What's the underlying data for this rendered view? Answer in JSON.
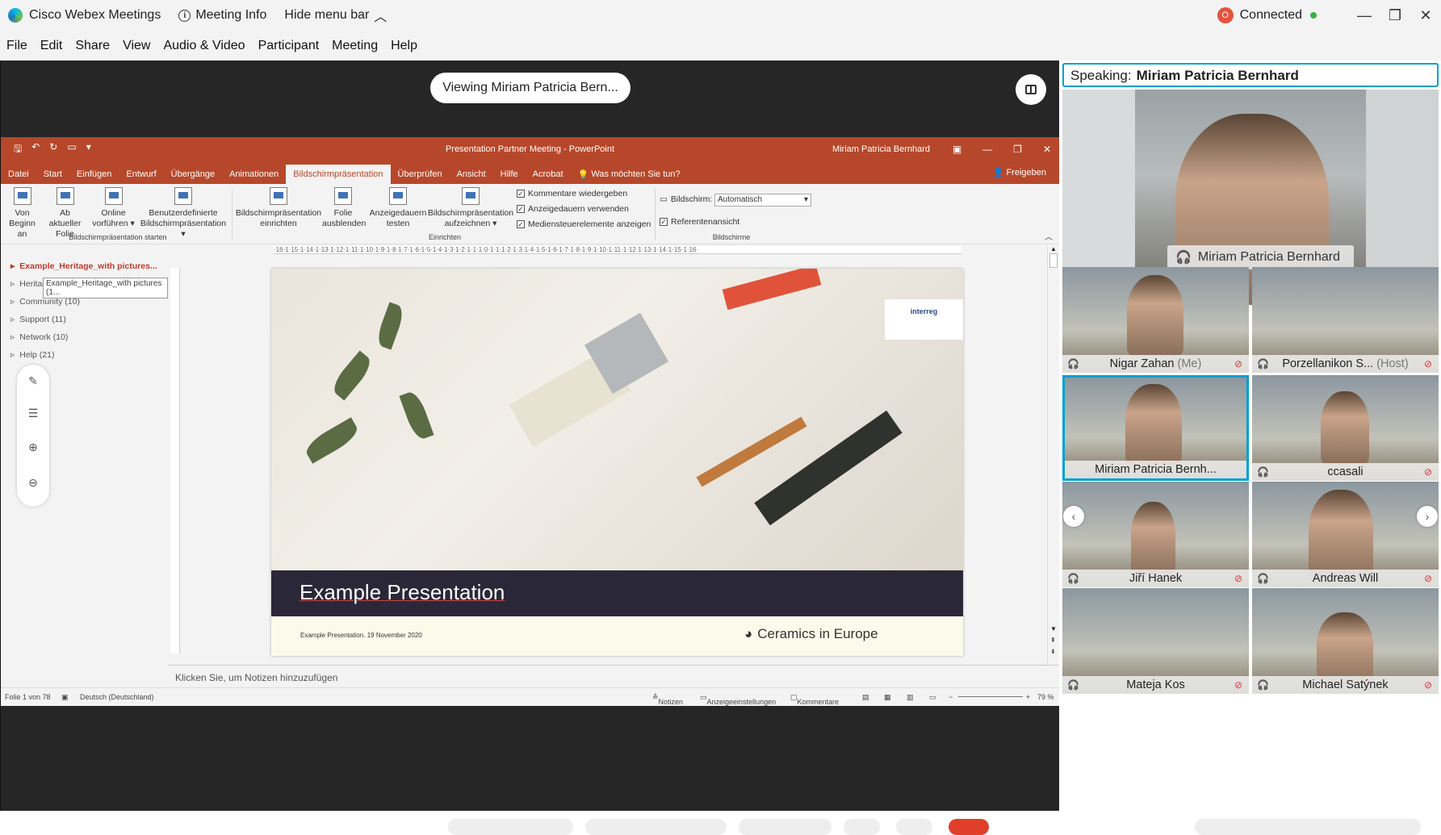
{
  "titlebar": {
    "app_name": "Cisco Webex Meetings",
    "meeting_info": "Meeting Info",
    "hide_menu": "Hide menu bar",
    "status": "Connected"
  },
  "menu": [
    "File",
    "Edit",
    "Share",
    "View",
    "Audio & Video",
    "Participant",
    "Meeting",
    "Help"
  ],
  "stage": {
    "viewing_label": "Viewing Miriam Patricia Bern..."
  },
  "ppt": {
    "doc_title": "Presentation Partner Meeting  -  PowerPoint",
    "user": "Miriam Patricia Bernhard",
    "tabs": [
      "Datei",
      "Start",
      "Einfügen",
      "Entwurf",
      "Übergänge",
      "Animationen",
      "Bildschirmpräsentation",
      "Überprüfen",
      "Ansicht",
      "Hilfe",
      "Acrobat",
      "Was möchten Sie tun?"
    ],
    "share": "Freigeben",
    "ribbon": {
      "from_start": [
        "Von",
        "Beginn an"
      ],
      "from_current": [
        "Ab aktueller",
        "Folie"
      ],
      "online": [
        "Online",
        "vorführen"
      ],
      "custom": [
        "Benutzerdefinierte",
        "Bildschirmpräsentation"
      ],
      "group1": "Bildschirmpräsentation starten",
      "setup": [
        "Bildschirmpräsentation",
        "einrichten"
      ],
      "hide": [
        "Folie",
        "ausblenden"
      ],
      "rehearse": [
        "Anzeigedauern",
        "testen"
      ],
      "record": [
        "Bildschirmpräsentation",
        "aufzeichnen"
      ],
      "chk1": "Kommentare wiedergeben",
      "chk2": "Anzeigedauern verwenden",
      "chk3": "Mediensteuerelemente anzeigen",
      "group2": "Einrichten",
      "monitor_label": "Bildschirm:",
      "monitor_value": "Automatisch",
      "presenter_view": "Referentenansicht",
      "group3": "Bildschirme"
    },
    "outline": [
      {
        "label": "Example_Heritage_with pictures...",
        "selected": true
      },
      {
        "label": "Heritage (10)",
        "selected": false
      },
      {
        "label": "Community (10)",
        "selected": false
      },
      {
        "label": "Support (11)",
        "selected": false
      },
      {
        "label": "Network (10)",
        "selected": false
      },
      {
        "label": "Help (21)",
        "selected": false
      }
    ],
    "tooltip": "Example_Heritage_with pictures (1...",
    "ruler": "·16·1·15·1·14·1·13·1·12·1·11·1·10·1·9·1·8·1·7·1·6·1·5·1·4·1·3·1·2·1·1·1·0·1·1·1·2·1·3·1·4·1·5·1·6·1·7·1·8·1·9·1·10·1·11·1·12·1·13·1·14·1·15·1·16·",
    "slide": {
      "title": "Example Presentation",
      "footer_small": "Example Presentation. 19 November 2020",
      "brand": "Ceramics in Europe",
      "logo": "interreg"
    },
    "notes_placeholder": "Klicken Sie, um Notizen hinzuzufügen",
    "status": {
      "slide": "Folie 1 von 78",
      "lang": "Deutsch (Deutschland)",
      "notes": "Notizen",
      "display": "Anzeigeeinstellungen",
      "comments": "Kommentare",
      "zoom": "79 %"
    }
  },
  "panel": {
    "speaking_label": "Speaking:",
    "speaking_name": "Miriam Patricia Bernhard",
    "main_name": "Miriam Patricia Bernhard",
    "tiles": [
      {
        "name": "Nigar Zahan",
        "suffix": "(Me)",
        "muted": true
      },
      {
        "name": "Porzellanikon S...",
        "suffix": "(Host)",
        "muted": true
      },
      {
        "name": "Miriam Patricia Bernh...",
        "suffix": "",
        "muted": false
      },
      {
        "name": "ccasali",
        "suffix": "",
        "muted": true
      },
      {
        "name": "Jiří Hanek",
        "suffix": "",
        "muted": true
      },
      {
        "name": "Andreas Will",
        "suffix": "",
        "muted": true
      },
      {
        "name": "Mateja Kos",
        "suffix": "",
        "muted": true
      },
      {
        "name": "Michael Satýnek",
        "suffix": "",
        "muted": true
      }
    ]
  },
  "colors": {
    "ppt_accent": "#b7472a",
    "webex_select": "#00a0d1",
    "connected": "#3cb043"
  }
}
